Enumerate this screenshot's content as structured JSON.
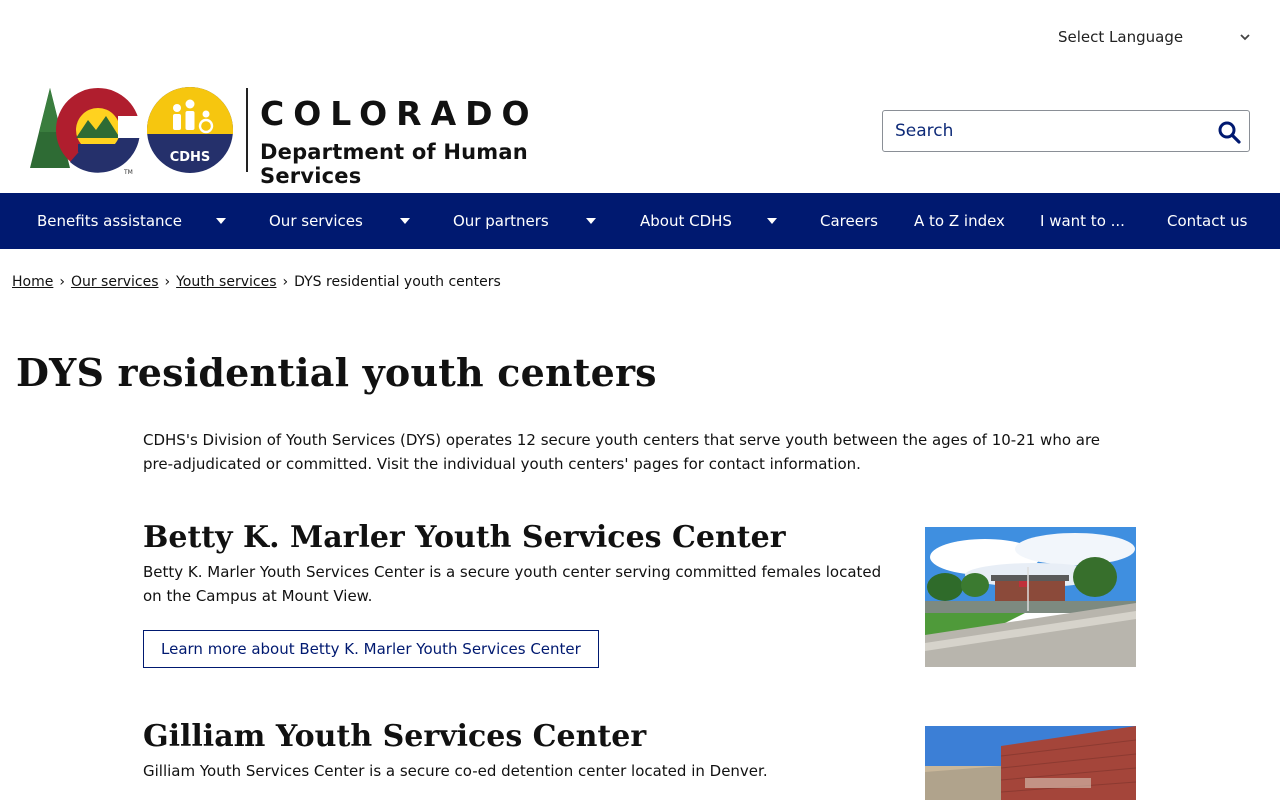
{
  "language": {
    "label": "Select Language"
  },
  "logo": {
    "state": "COLORADO",
    "department": "Department of Human Services",
    "badge": "CDHS"
  },
  "search": {
    "placeholder": "Search"
  },
  "nav": {
    "items": [
      {
        "label": "Benefits assistance",
        "has_dropdown": true
      },
      {
        "label": "Our services",
        "has_dropdown": true
      },
      {
        "label": "Our partners",
        "has_dropdown": true
      },
      {
        "label": "About CDHS",
        "has_dropdown": true
      },
      {
        "label": "Careers",
        "has_dropdown": false
      },
      {
        "label": "A to Z index",
        "has_dropdown": false
      },
      {
        "label": "I want to ...",
        "has_dropdown": false
      },
      {
        "label": "Contact us",
        "has_dropdown": false
      }
    ]
  },
  "breadcrumb": {
    "links": [
      "Home",
      "Our services",
      "Youth services"
    ],
    "separator": "›",
    "current": "DYS residential youth centers"
  },
  "page": {
    "title": "DYS residential youth centers",
    "intro": "CDHS's Division of Youth Services (DYS) operates 12 secure youth centers that serve youth between the ages of 10-21 who are pre-adjudicated or committed. Visit the individual youth centers' pages for contact information."
  },
  "centers": [
    {
      "name": "Betty K. Marler Youth Services Center",
      "description": "Betty K. Marler Youth Services Center is a secure youth center serving committed females located on the Campus at Mount View.",
      "link": "Learn more about Betty K. Marler Youth Services Center"
    },
    {
      "name": "Gilliam Youth Services Center",
      "description": "Gilliam Youth Services Center is a secure co-ed detention center located in Denver."
    }
  ],
  "colors": {
    "nav_bg": "#001970",
    "link_blue": "#0e2a78",
    "text": "#111111"
  }
}
